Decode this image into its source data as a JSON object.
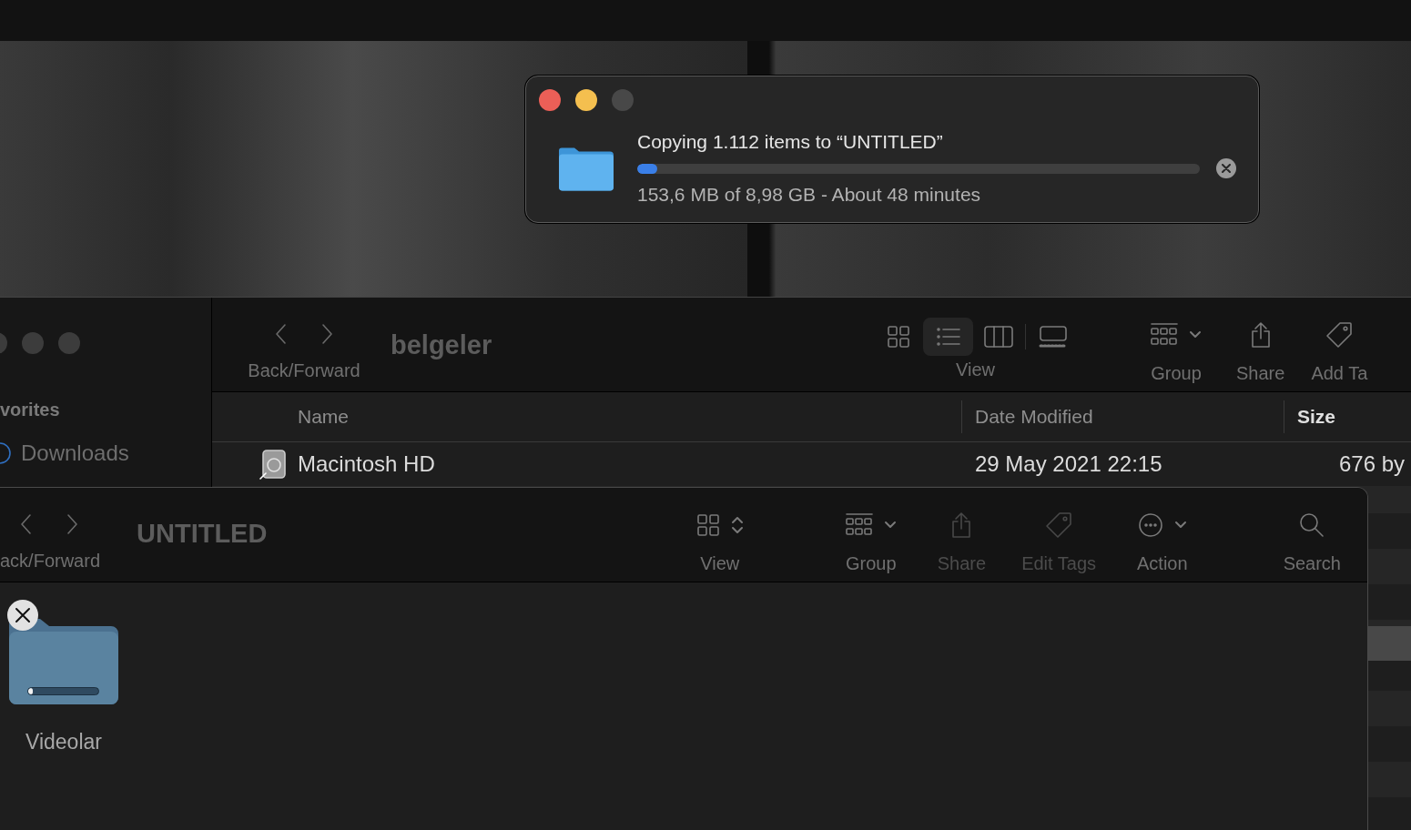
{
  "copy_dialog": {
    "title": "Copying 1.112 items to “UNTITLED”",
    "level": 0.035,
    "status": "153,6 MB of 8,98 GB - About 48 minutes"
  },
  "back_window": {
    "sidebar": {
      "section": "vorites",
      "items": [
        {
          "label": "Downloads"
        }
      ]
    },
    "toolbar": {
      "nav_label": "Back/Forward",
      "title": "belgeler",
      "view_label": "View",
      "view_modes": [
        {
          "kind": "icons",
          "selected": false
        },
        {
          "kind": "list",
          "selected": true
        },
        {
          "kind": "columns",
          "selected": false
        },
        {
          "kind": "gallery",
          "selected": false
        }
      ],
      "items": [
        {
          "kind": "group",
          "label": "Group"
        },
        {
          "kind": "share",
          "label": "Share"
        },
        {
          "kind": "tag",
          "label": "Add Ta"
        }
      ]
    },
    "table": {
      "columns": [
        {
          "label": "Name",
          "sorted": false
        },
        {
          "label": "Date Modified",
          "sorted": false
        },
        {
          "label": "Size",
          "sorted": true
        }
      ],
      "rows": [
        {
          "name": "Macintosh HD",
          "date_modified": "29 May 2021 22:15",
          "size": "676 by"
        }
      ]
    }
  },
  "front_window": {
    "toolbar": {
      "nav_label": "ack/Forward",
      "title": "UNTITLED",
      "items": [
        {
          "kind": "view",
          "label": "View",
          "disabled": false
        },
        {
          "kind": "group",
          "label": "Group",
          "disabled": false
        },
        {
          "kind": "share",
          "label": "Share",
          "disabled": true
        },
        {
          "kind": "tag",
          "label": "Edit Tags",
          "disabled": true
        },
        {
          "kind": "action",
          "label": "Action",
          "disabled": false
        },
        {
          "kind": "search",
          "label": "Search",
          "disabled": false
        }
      ]
    },
    "items": [
      {
        "name": "Videolar",
        "copying": true,
        "level": 0.06
      }
    ]
  }
}
